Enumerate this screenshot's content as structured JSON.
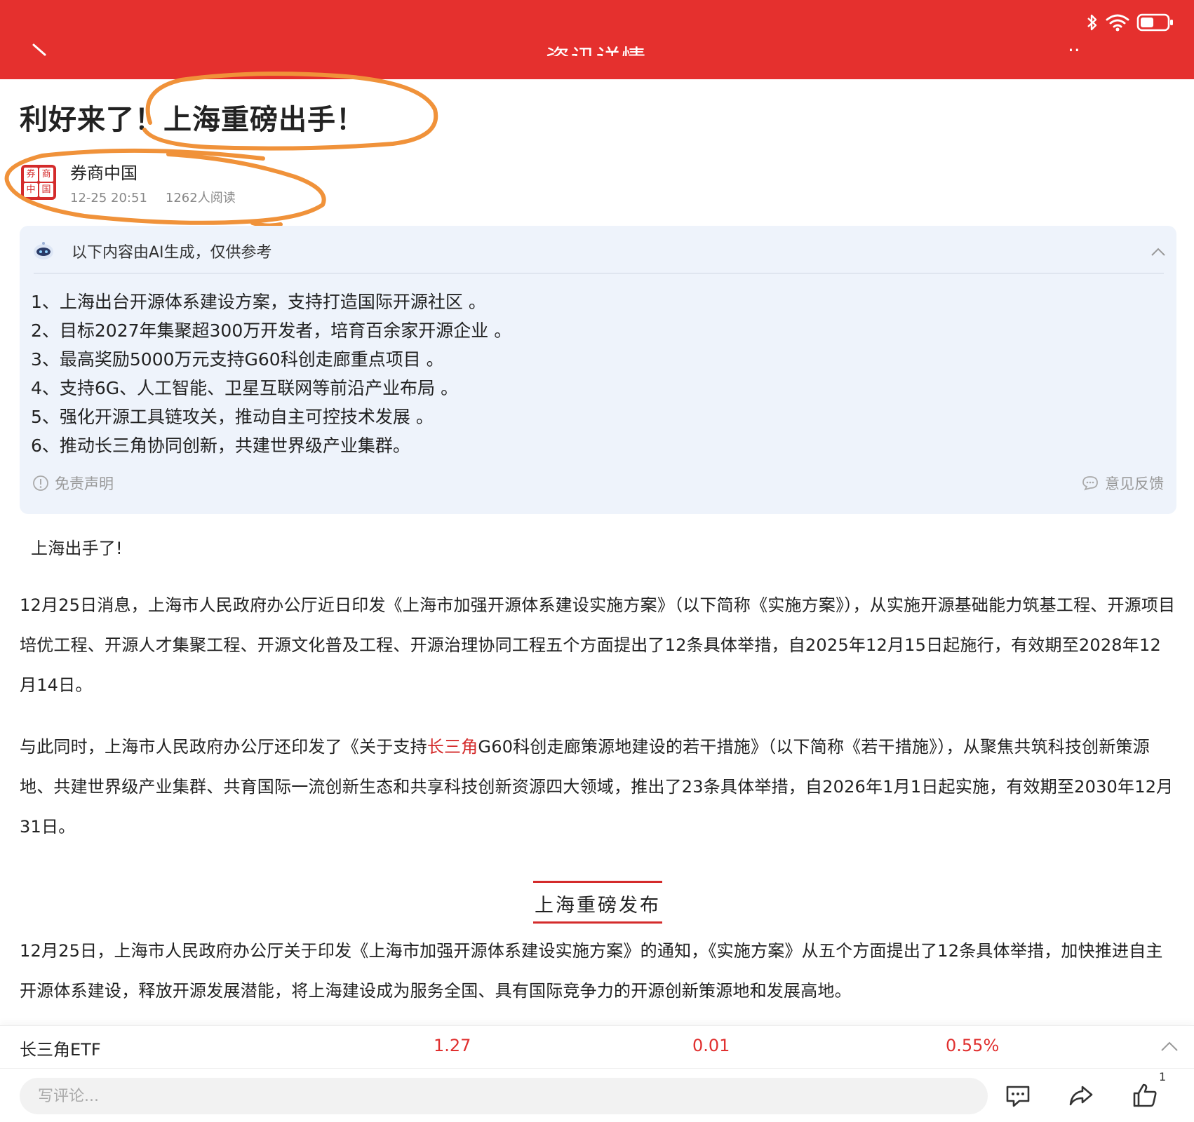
{
  "header": {
    "title": "资讯详情",
    "more_label": "··"
  },
  "article": {
    "headline": "利好来了！上海重磅出手！",
    "source": "券商中国",
    "logo_chars": [
      "券",
      "商",
      "中",
      "国"
    ],
    "datetime": "12-25 20:51",
    "reads": "1262人阅读"
  },
  "ai_summary": {
    "label": "以下内容由AI生成，仅供参考",
    "items": [
      "1、上海出台开源体系建设方案，支持打造国际开源社区 。",
      "2、目标2027年集聚超300万开发者，培育百余家开源企业 。",
      "3、最高奖励5000万元支持G60科创走廊重点项目 。",
      "4、支持6G、人工智能、卫星互联网等前沿产业布局 。",
      "5、强化开源工具链攻关，推动自主可控技术发展 。",
      "6、推动长三角协同创新，共建世界级产业集群。"
    ],
    "disclaimer": "免责声明",
    "feedback": "意见反馈"
  },
  "body": {
    "intro": "上海出手了!",
    "p1": "12月25日消息，上海市人民政府办公厅近日印发《上海市加强开源体系建设实施方案》（以下简称《实施方案》），从实施开源基础能力筑基工程、开源项目培优工程、开源人才集聚工程、开源文化普及工程、开源治理协同工程五个方面提出了12条具体举措，自2025年12月15日起施行，有效期至2028年12月14日。",
    "p2_before": "与此同时，上海市人民政府办公厅还印发了《关于支持",
    "p2_link": "长三角",
    "p2_after": "G60科创走廊策源地建设的若干措施》（以下简称《若干措施》），从聚焦共筑科技创新策源地、共建世界级产业集群、共育国际一流创新生态和共享科技创新资源四大领域，推出了23条具体举措，自2026年1月1日起实施，有效期至2030年12月31日。",
    "section_title": "上海重磅发布",
    "p3": "12月25日，上海市人民政府办公厅关于印发《上海市加强开源体系建设实施方案》的通知，《实施方案》从五个方面提出了12条具体举措，加快推进自主开源体系建设，释放开源发展潜能，将上海建设成为服务全国、具有国际竞争力的开源创新策源地和发展高地。"
  },
  "etf": {
    "name": "长三角ETF",
    "price": "1.27",
    "change": "0.01",
    "change_pct": "0.55%"
  },
  "bottom": {
    "comment_placeholder": "写评论...",
    "like_count": "1"
  },
  "colors": {
    "brand_red": "#e5302e",
    "annotation_orange": "#f0923a",
    "ai_box_bg": "#eef3fb"
  }
}
